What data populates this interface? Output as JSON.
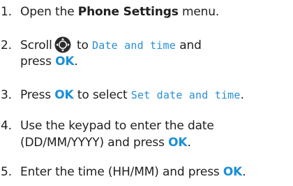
{
  "steps": [
    {
      "num": "1.",
      "pre": "Open the ",
      "bold": "Phone Settings",
      "post": " menu."
    },
    {
      "num": "2.",
      "pre": "Scroll",
      "icon": "scroll-navigation-icon",
      "mid": " to ",
      "lcd": "Date and time",
      "post": " and",
      "line2_post": "press ",
      "ok": "OK",
      "line2_end": "."
    },
    {
      "num": "3.",
      "pre": "Press ",
      "ok": "OK",
      "mid": " to select ",
      "lcd": "Set date and time",
      "post": "."
    },
    {
      "num": "4.",
      "text": "Use the keypad to enter the date",
      "line2_pre": "(DD/MM/YYYY) and press ",
      "ok": "OK",
      "line2_end": "."
    },
    {
      "num": "5.",
      "pre": "Enter the time (HH/MM) and press ",
      "ok": "OK",
      "post": "."
    }
  ],
  "colors": {
    "accent": "#1a8fd8",
    "lcd_text": "#2a8fd6",
    "body_text": "#1f1f1f"
  }
}
